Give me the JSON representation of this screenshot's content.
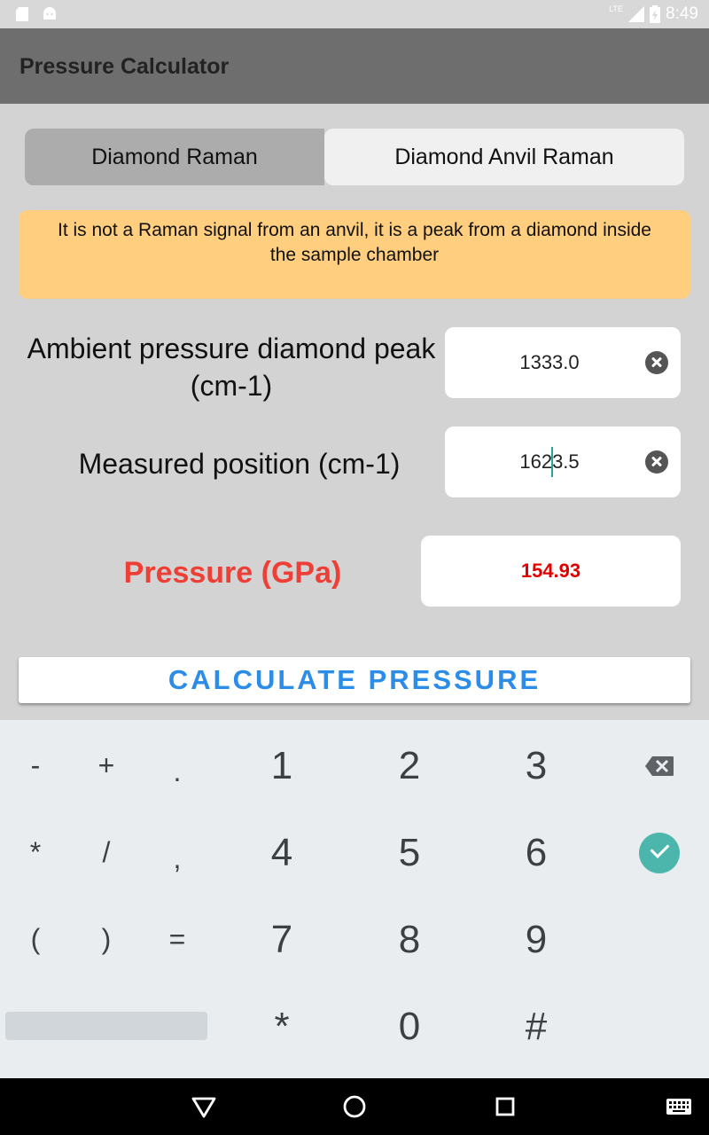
{
  "status_bar": {
    "time": "8:49",
    "network": "LTE"
  },
  "app_bar": {
    "title": "Pressure Calculator"
  },
  "tabs": {
    "left": "Diamond Raman",
    "right": "Diamond Anvil Raman"
  },
  "info_text": "It is not a Raman signal from an anvil, it is a peak from a diamond inside the sample chamber",
  "form": {
    "ambient_label": "Ambient pressure diamond peak (cm-1)",
    "ambient_value": "1333.0",
    "measured_label": "Measured position (cm-1)",
    "measured_value_before_cursor": "162",
    "measured_value_after_cursor": "3.5",
    "pressure_label": "Pressure (GPa)",
    "pressure_value": "154.93"
  },
  "calculate_button": "CALCULATE PRESSURE",
  "keyboard": {
    "row1": [
      "-",
      "+",
      ".",
      "1",
      "2",
      "3"
    ],
    "row2": [
      "*",
      "/",
      ",",
      "4",
      "5",
      "6"
    ],
    "row3": [
      "(",
      ")",
      "=",
      "7",
      "8",
      "9"
    ],
    "row4": [
      "*",
      "0",
      "#"
    ]
  },
  "colors": {
    "accent": "#2b8de8",
    "pressure_red": "#ee3f36",
    "info_bg": "#ffcf7f",
    "check_green": "#4db6ac"
  }
}
